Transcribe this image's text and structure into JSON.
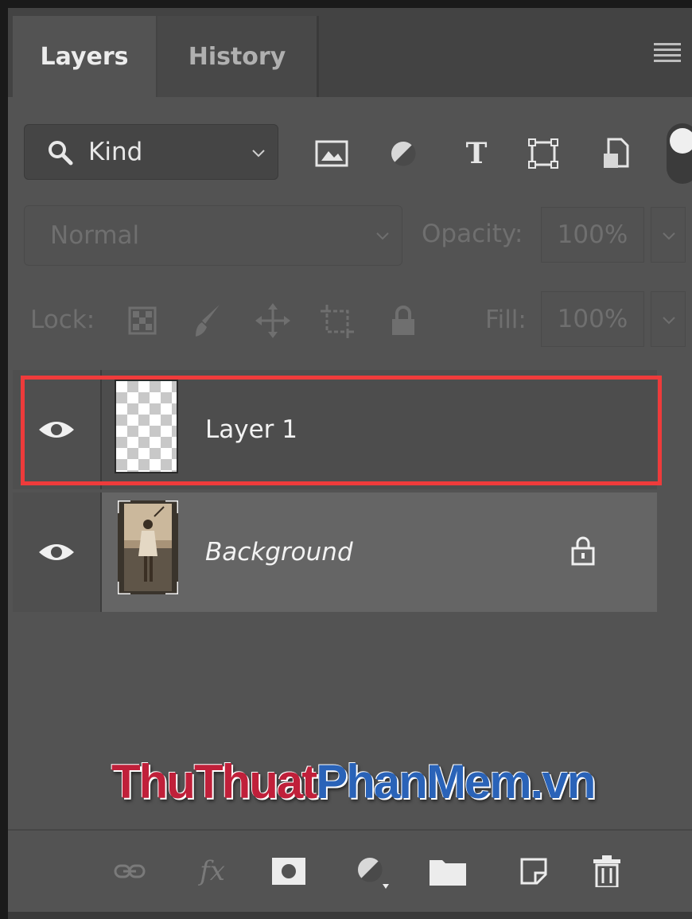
{
  "tabs": [
    {
      "label": "Layers"
    },
    {
      "label": "History"
    }
  ],
  "filter": {
    "kind_label": "Kind",
    "icons": [
      "image-filter-icon",
      "adjustment-filter-icon",
      "type-filter-icon",
      "shape-filter-icon",
      "smart-object-filter-icon"
    ]
  },
  "blend": {
    "mode": "Normal",
    "opacity_label": "Opacity:",
    "opacity_value": "100%"
  },
  "lock": {
    "label": "Lock:",
    "fill_label": "Fill:",
    "fill_value": "100%"
  },
  "layers": [
    {
      "name": "Layer 1",
      "visible": true,
      "locked": false,
      "selected": true
    },
    {
      "name": "Background",
      "visible": true,
      "locked": true,
      "selected": false
    }
  ],
  "watermark": {
    "part1": "ThuThuat",
    "part2": "PhanMem.vn"
  },
  "colors": {
    "highlight": "#ee3b3b",
    "panel": "#535353",
    "tab_bar": "#434343"
  },
  "bottom_icons": [
    "link-layers-icon",
    "fx-icon",
    "layer-mask-icon",
    "adjustment-layer-icon",
    "group-folder-icon",
    "new-layer-icon",
    "delete-layer-icon"
  ]
}
